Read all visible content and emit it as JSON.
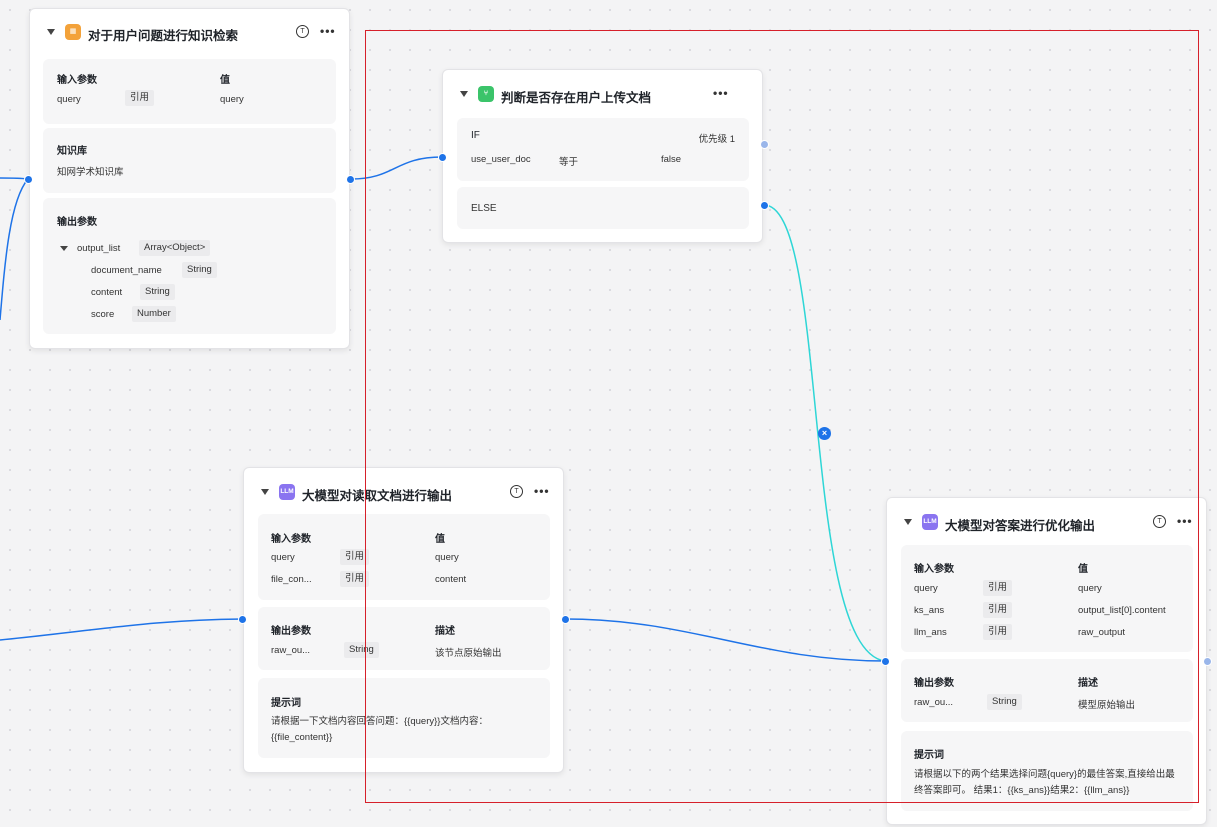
{
  "colors": {
    "accent": "#1e73e8",
    "wire": "#1e73e8",
    "wire_cyan": "#2ed6d6",
    "selection": "#d6202a",
    "llm_icon": "#8a74f0",
    "kb_icon": "#f3a23a",
    "cond_icon": "#3bc46a"
  },
  "kb_node": {
    "title": "对于用户问题进行知识检索",
    "icon": "knowledge-base-icon",
    "input_params": {
      "label": "输入参数",
      "value_header": "值",
      "rows": [
        {
          "name": "query",
          "type": "引用",
          "value": "query"
        }
      ]
    },
    "knowledge": {
      "label": "知识库",
      "value": "知网学术知识库"
    },
    "output_params": {
      "label": "输出参数",
      "root": {
        "name": "output_list",
        "type": "Array<Object>"
      },
      "children": [
        {
          "name": "document_name",
          "type": "String"
        },
        {
          "name": "content",
          "type": "String"
        },
        {
          "name": "score",
          "type": "Number"
        }
      ]
    }
  },
  "cond_node": {
    "title": "判断是否存在用户上传文档",
    "icon": "condition-icon",
    "if_label": "IF",
    "priority": "优先级 1",
    "condition": {
      "var": "use_user_doc",
      "op": "等于",
      "value": "false"
    },
    "else_label": "ELSE"
  },
  "llm1_node": {
    "title": "大模型对读取文档进行输出",
    "icon_text": "LLM",
    "input_params": {
      "label": "输入参数",
      "value_header": "值",
      "rows": [
        {
          "name": "query",
          "type": "引用",
          "value": "query"
        },
        {
          "name": "file_con...",
          "type": "引用",
          "value": "content"
        }
      ]
    },
    "output_params": {
      "label": "输出参数",
      "desc_header": "描述",
      "rows": [
        {
          "name": "raw_ou...",
          "type": "String",
          "desc": "该节点原始输出"
        }
      ]
    },
    "prompt": {
      "label": "提示词",
      "text": "请根据一下文档内容回答问题：{{query}}文档内容：{{file_content}}"
    }
  },
  "llm2_node": {
    "title": "大模型对答案进行优化输出",
    "icon_text": "LLM",
    "input_params": {
      "label": "输入参数",
      "value_header": "值",
      "rows": [
        {
          "name": "query",
          "type": "引用",
          "value": "query"
        },
        {
          "name": "ks_ans",
          "type": "引用",
          "value": "output_list[0].content"
        },
        {
          "name": "llm_ans",
          "type": "引用",
          "value": "raw_output"
        }
      ]
    },
    "output_params": {
      "label": "输出参数",
      "desc_header": "描述",
      "rows": [
        {
          "name": "raw_ou...",
          "type": "String",
          "desc": "模型原始输出"
        }
      ]
    },
    "prompt": {
      "label": "提示词",
      "text": "请根据以下的两个结果选择问题{query}的最佳答案,直接给出最终答案即可。 结果1：{{ks_ans}}结果2：{{llm_ans}}"
    }
  },
  "glyphs": {
    "trigger": "T",
    "more": "•••",
    "llm": "LLM",
    "close": "×"
  }
}
